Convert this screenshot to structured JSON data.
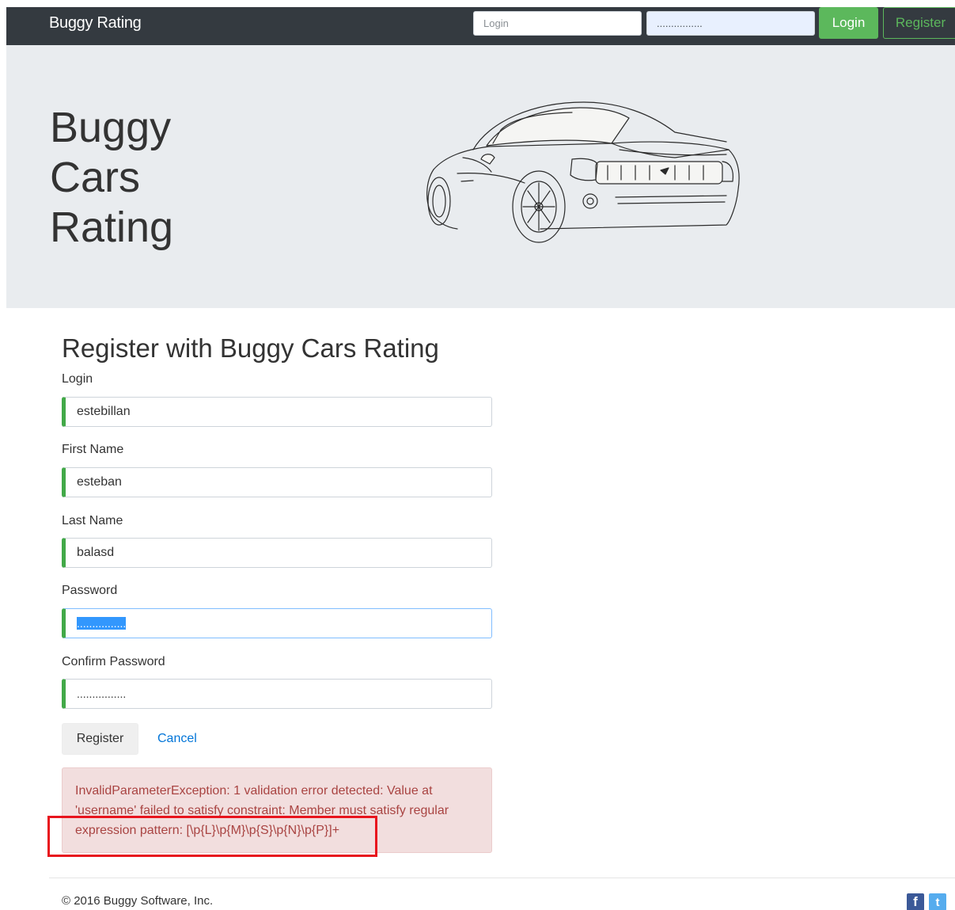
{
  "navbar": {
    "brand": "Buggy Rating",
    "login_placeholder": "Login",
    "password_value": "................",
    "login_button": "Login",
    "register_button": "Register"
  },
  "hero": {
    "title_lines": [
      "Buggy",
      "Cars",
      "Rating"
    ],
    "image": "car-sketch-illustration"
  },
  "form": {
    "title": "Register with Buggy Cars Rating",
    "fields": [
      {
        "label": "Login",
        "value": "estebillan"
      },
      {
        "label": "First Name",
        "value": "esteban"
      },
      {
        "label": "Last Name",
        "value": "balasd"
      },
      {
        "label": "Password",
        "value": "................"
      },
      {
        "label": "Confirm Password",
        "value": "................"
      }
    ],
    "register_button": "Register",
    "cancel_link": "Cancel",
    "error_message": "InvalidParameterException: 1 validation error detected: Value at 'username' failed to satisfy constraint: Member must satisfy regular expression pattern: [\\p{L}\\p{M}\\p{S}\\p{N}\\p{P}]+"
  },
  "footer": {
    "copyright": "© 2016 Buggy Software, Inc.",
    "social": [
      "facebook-icon",
      "twitter-icon"
    ]
  },
  "colors": {
    "navbar_bg": "#343a40",
    "success_green": "#5cb85c",
    "hero_bg": "#e9ecef",
    "error_text": "#a94442",
    "error_bg": "#f2dede",
    "link_blue": "#0275d8",
    "annotation_red": "#e8141d"
  }
}
